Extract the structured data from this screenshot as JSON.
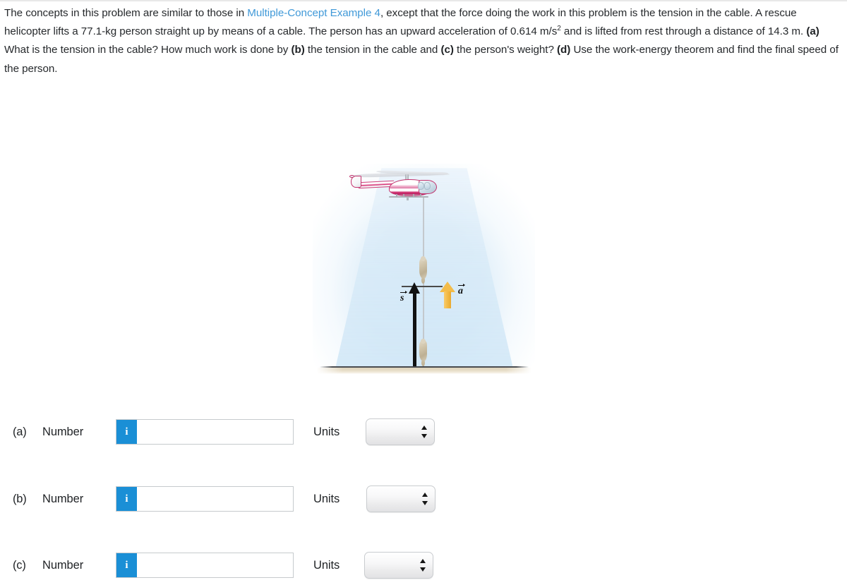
{
  "problem": {
    "part1": "The concepts in this problem are similar to those in ",
    "link_text": "Multiple-Concept Example 4",
    "part2": ", except that the force doing the work in this problem is the tension in the cable. A rescue helicopter lifts a 77.1-kg person straight up by means of a cable. The person has an upward acceleration of 0.614 m/s",
    "exponent": "2",
    "part3": " and is lifted from rest through a distance of 14.3 m. ",
    "bold_a": "(a)",
    "part4": " What is the tension in the cable? How much work is done by ",
    "bold_b": "(b)",
    "part5": " the tension in the cable and ",
    "bold_c": "(c)",
    "part6": " the person's weight? ",
    "bold_d": "(d)",
    "part7": " Use the work-energy theorem and find the final speed of the person."
  },
  "figure": {
    "caption": "",
    "displacement_label": "s",
    "acceleration_label": "a",
    "sky_color": "#d5e9f7",
    "ground_color": "#e2d7bf",
    "helicopter_color": "#cf2e70",
    "acceleration_arrow_color": "#f3bc4a",
    "displacement_arrow_color": "#111111"
  },
  "answers": [
    {
      "letter": "(a)",
      "number_label": "Number",
      "info_icon": "i",
      "value": "",
      "placeholder": "",
      "units_label": "Units",
      "units_value": ""
    },
    {
      "letter": "(b)",
      "number_label": "Number",
      "info_icon": "i",
      "value": "",
      "placeholder": "",
      "units_label": "Units",
      "units_value": ""
    },
    {
      "letter": "(c)",
      "number_label": "Number",
      "info_icon": "i",
      "value": "",
      "placeholder": "",
      "units_label": "Units",
      "units_value": ""
    }
  ]
}
